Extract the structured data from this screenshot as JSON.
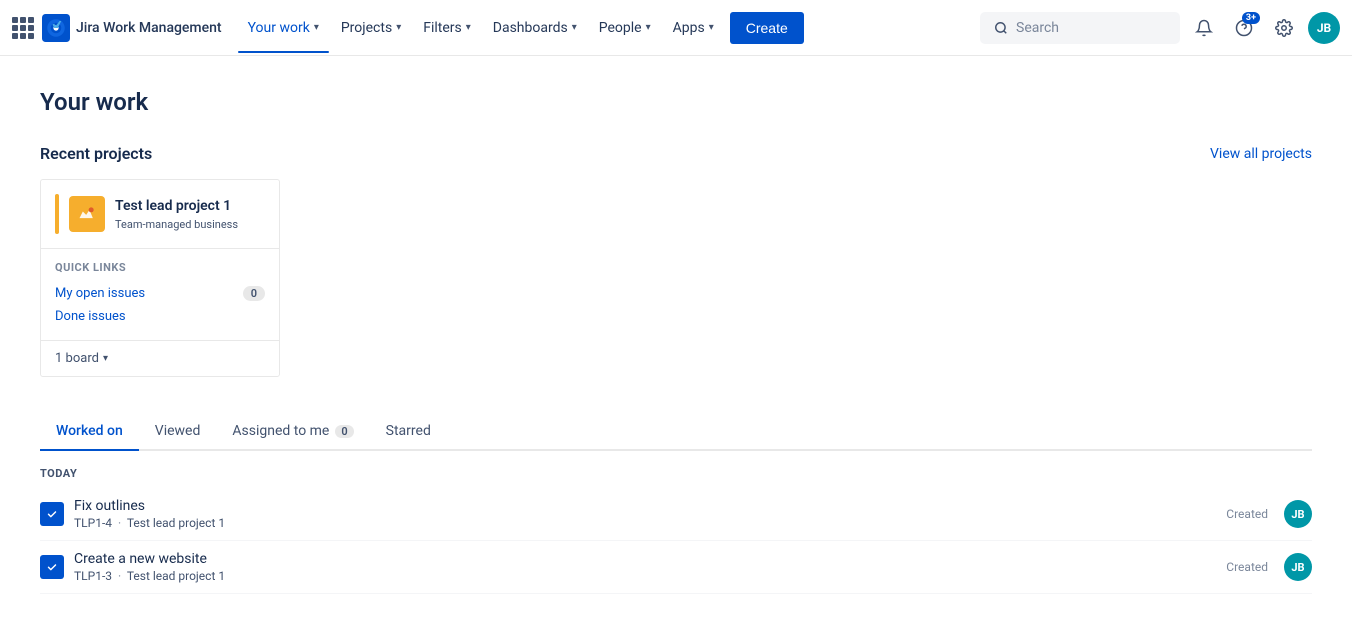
{
  "app": {
    "logo_text": "Jira Work Management",
    "nav_items": [
      {
        "id": "your-work",
        "label": "Your work",
        "active": true,
        "has_chevron": true
      },
      {
        "id": "projects",
        "label": "Projects",
        "active": false,
        "has_chevron": true
      },
      {
        "id": "filters",
        "label": "Filters",
        "active": false,
        "has_chevron": true
      },
      {
        "id": "dashboards",
        "label": "Dashboards",
        "active": false,
        "has_chevron": true
      },
      {
        "id": "people",
        "label": "People",
        "active": false,
        "has_chevron": true
      },
      {
        "id": "apps",
        "label": "Apps",
        "active": false,
        "has_chevron": true
      }
    ],
    "create_label": "Create",
    "search_placeholder": "Search",
    "notification_badge": "3+",
    "user_initials": "JB"
  },
  "page": {
    "title": "Your work",
    "recent_projects_label": "Recent projects",
    "view_all_label": "View all projects"
  },
  "project_card": {
    "name": "Test lead project 1",
    "type": "Team-managed business",
    "quick_links_label": "QUICK LINKS",
    "links": [
      {
        "label": "My open issues",
        "count": "0"
      },
      {
        "label": "Done issues",
        "count": null
      }
    ],
    "board_label": "1 board"
  },
  "tabs": [
    {
      "id": "worked-on",
      "label": "Worked on",
      "active": true,
      "badge": null
    },
    {
      "id": "viewed",
      "label": "Viewed",
      "active": false,
      "badge": null
    },
    {
      "id": "assigned-to-me",
      "label": "Assigned to me",
      "active": false,
      "badge": "0"
    },
    {
      "id": "starred",
      "label": "Starred",
      "active": false,
      "badge": null
    }
  ],
  "work_items": {
    "today_label": "TODAY",
    "items": [
      {
        "id": "item-1",
        "title": "Fix outlines",
        "meta_id": "TLP1-4",
        "meta_project": "Test lead project 1",
        "status": "Created",
        "avatar": "JB"
      },
      {
        "id": "item-2",
        "title": "Create a new website",
        "meta_id": "TLP1-3",
        "meta_project": "Test lead project 1",
        "status": "Created",
        "avatar": "JB"
      }
    ]
  }
}
